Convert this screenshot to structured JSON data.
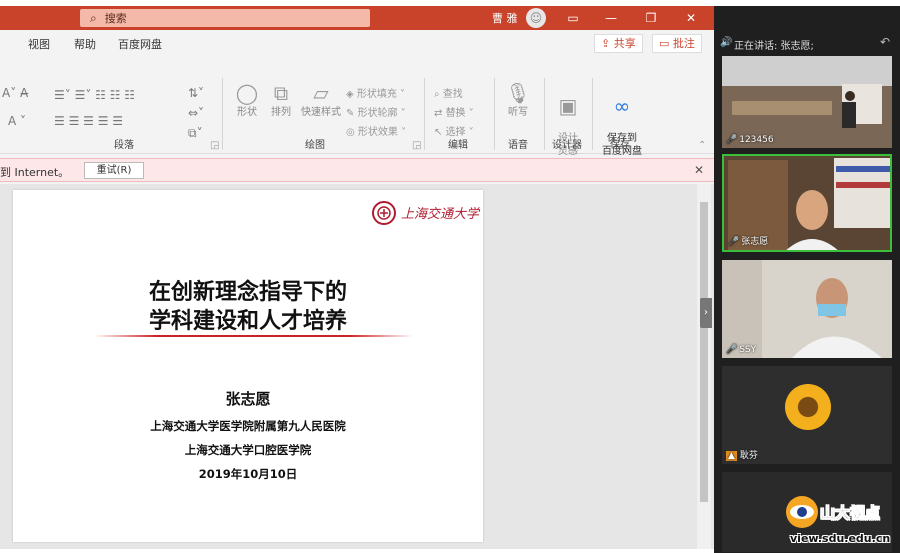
{
  "titlebar": {
    "search_placeholder": "搜索",
    "user_name": "曹 雅"
  },
  "menubar": {
    "items": [
      "视图",
      "帮助",
      "百度网盘"
    ],
    "share_label": "共享",
    "comment_label": "批注"
  },
  "ribbon": {
    "shape_buttons": [
      "形状",
      "排列",
      "快速样式"
    ],
    "shape_options": [
      "形状填充",
      "形状轮廓",
      "形状效果"
    ],
    "edit_options": [
      "查找",
      "替换",
      "选择"
    ],
    "dictate_label": "听写",
    "designer_label": "设计\n灵感",
    "save_label": "保存到\n百度网盘",
    "groups": [
      "段落",
      "绘图",
      "编辑",
      "语音",
      "设计器",
      "保存"
    ]
  },
  "infobar": {
    "message": "到 Internet。",
    "retry_label": "重试(R)"
  },
  "slide": {
    "logo_text": "上海交通大学",
    "title_line1": "在创新理念指导下的",
    "title_line2": "学科建设和人才培养",
    "author": "张志愿",
    "affiliation1": "上海交通大学医学院附属第九人民医院",
    "affiliation2": "上海交通大学口腔医学院",
    "date": "2019年10月10日"
  },
  "meeting": {
    "speaking": "正在讲话: 张志愿;",
    "participants": [
      {
        "label": "123456"
      },
      {
        "label": "张志愿"
      },
      {
        "label": "SSY"
      },
      {
        "label": "耿芬"
      }
    ]
  },
  "watermark": {
    "title": "山大视点",
    "url": "view.sdu.edu.cn"
  },
  "colors": {
    "titlebar": "#c9432b",
    "infobar": "#fde7e9",
    "meeting_bg": "#1f1f1f",
    "active_speaker_border": "#3bbf3b"
  }
}
